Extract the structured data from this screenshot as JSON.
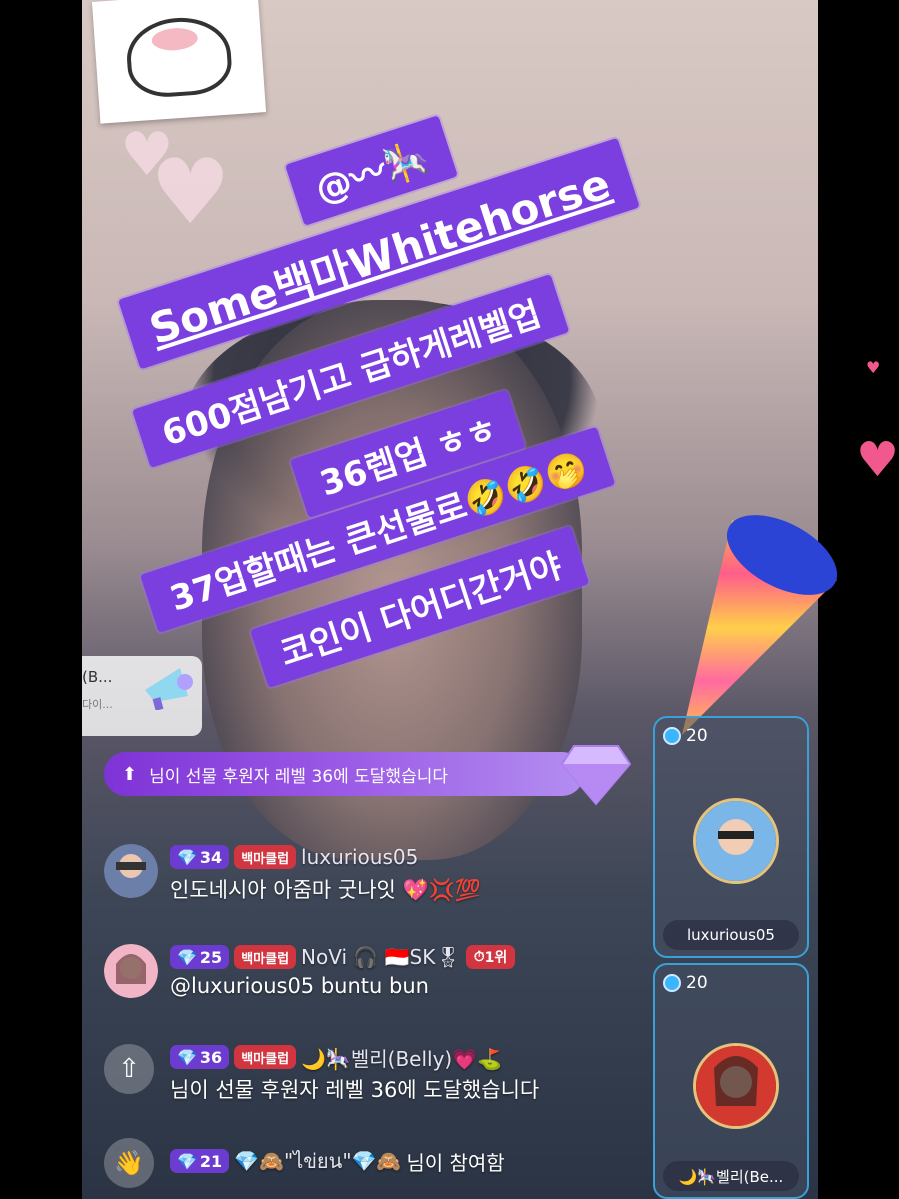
{
  "caption": {
    "line1": "@〰🎠",
    "line2": "Some백마Whitehorse",
    "line3": "600점남기고  급하게레벨업",
    "line4": "36렙업  ㅎㅎ",
    "line5": "37업할때는  큰선물로🤣🤣🤭",
    "line6": "코인이  다어디간거야"
  },
  "left_card": {
    "name": "(B...",
    "sub": "다이..."
  },
  "level_banner": {
    "text": "님이 선물 후원자 레벨 36에 도달했습니다"
  },
  "chat": [
    {
      "level": "34",
      "club": "백마클럽",
      "user": "luxurious05",
      "text": "인도네시아  아줌마 굿나잇 💖💢💯"
    },
    {
      "level": "25",
      "club": "백마클럽",
      "user": "NoVi 🎧 🇮🇩SK🎖",
      "rank": "1위",
      "text": "@luxurious05 buntu bun"
    },
    {
      "level": "36",
      "club": "백마클럽",
      "user": "🌙🎠벨리(Belly)💗⛳",
      "text": "님이 선물 후원자 레벨 36에 도달했습니다"
    },
    {
      "level": "21",
      "user": "💎🙈\"ไข่ยน\"💎🙈",
      "text": "님이 참여함"
    }
  ],
  "gift_cards": [
    {
      "coins": "20",
      "name": "luxurious05"
    },
    {
      "coins": "20",
      "name": "🌙🎠벨리(Be..."
    }
  ],
  "colors": {
    "caption_bg": "#7b3fe0",
    "club_badge": "#d13640",
    "level_badge": "#6b3ccf",
    "card_border": "#3aa0d8"
  }
}
